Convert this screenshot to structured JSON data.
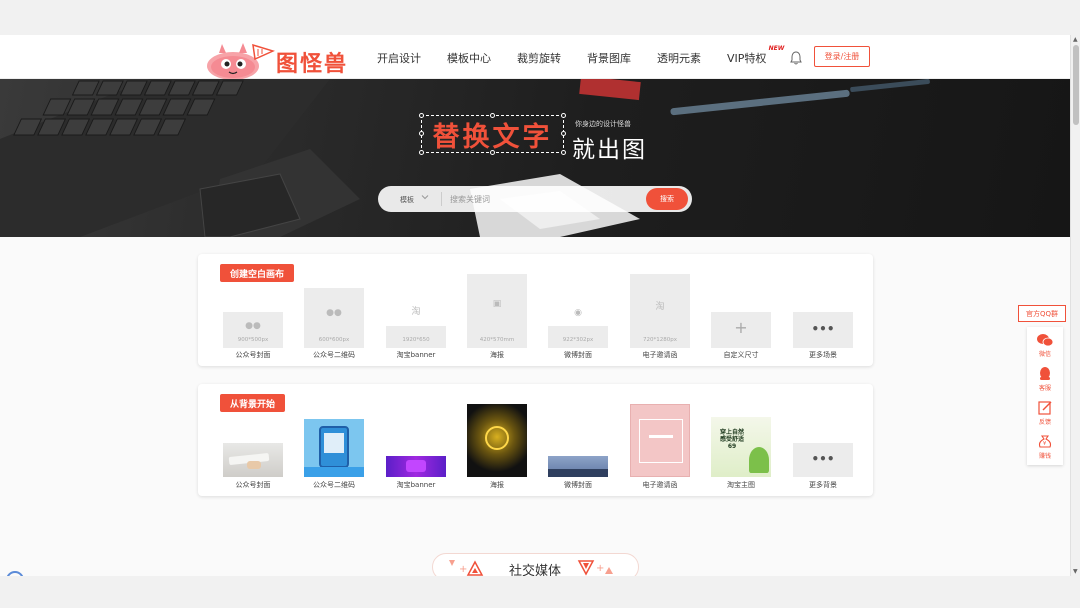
{
  "header": {
    "logo_text": "图怪兽",
    "nav": [
      {
        "label": "开启设计"
      },
      {
        "label": "模板中心"
      },
      {
        "label": "裁剪旋转"
      },
      {
        "label": "背景图库"
      },
      {
        "label": "透明元素"
      },
      {
        "label": "VIP特权",
        "badge": "NEW"
      }
    ],
    "login_label": "登录/注册",
    "bell_icon": "bell-icon"
  },
  "hero": {
    "title_highlight": "替换文字",
    "subtitle_small": "你身边的设计怪兽",
    "title_rest": "就出图",
    "search": {
      "type_label": "模板",
      "placeholder": "搜索关键词",
      "button_label": "搜索"
    }
  },
  "blank_canvas": {
    "tag": "创建空白画布",
    "items": [
      {
        "label": "公众号封面",
        "size": "900*500px",
        "icon": "wechat-icon"
      },
      {
        "label": "公众号二维码",
        "size": "600*600px",
        "icon": "wechat-icon"
      },
      {
        "label": "淘宝banner",
        "size": "1920*650",
        "icon": "taobao-icon"
      },
      {
        "label": "海报",
        "size": "420*570mm",
        "icon": "printer-icon"
      },
      {
        "label": "微博封面",
        "size": "922*302px",
        "icon": "weibo-icon"
      },
      {
        "label": "电子邀请函",
        "size": "720*1280px",
        "icon": "taobao-icon"
      },
      {
        "label": "自定义尺寸",
        "size": "",
        "icon": "plus-icon"
      },
      {
        "label": "更多场景",
        "size": "",
        "icon": "more-icon"
      }
    ]
  },
  "from_background": {
    "tag": "从背景开始",
    "items": [
      {
        "label": "公众号封面"
      },
      {
        "label": "公众号二维码"
      },
      {
        "label": "淘宝banner"
      },
      {
        "label": "海报"
      },
      {
        "label": "微博封面"
      },
      {
        "label": "电子邀请函"
      },
      {
        "label": "淘宝主图",
        "thumb_text": "穿上自然\n感受舒适\n69"
      },
      {
        "label": "更多背景"
      }
    ]
  },
  "float_panel": {
    "qq_label": "官方QQ群",
    "items": [
      {
        "label": "微信",
        "icon": "wechat-icon"
      },
      {
        "label": "客服",
        "icon": "support-icon"
      },
      {
        "label": "反馈",
        "icon": "edit-icon"
      },
      {
        "label": "赚钱",
        "icon": "money-bag-icon"
      }
    ]
  },
  "social_section": {
    "label": "社交媒体"
  },
  "colors": {
    "accent": "#f0513a",
    "hero_bg": "#1e1e1e",
    "tile_bg": "#ececec"
  }
}
